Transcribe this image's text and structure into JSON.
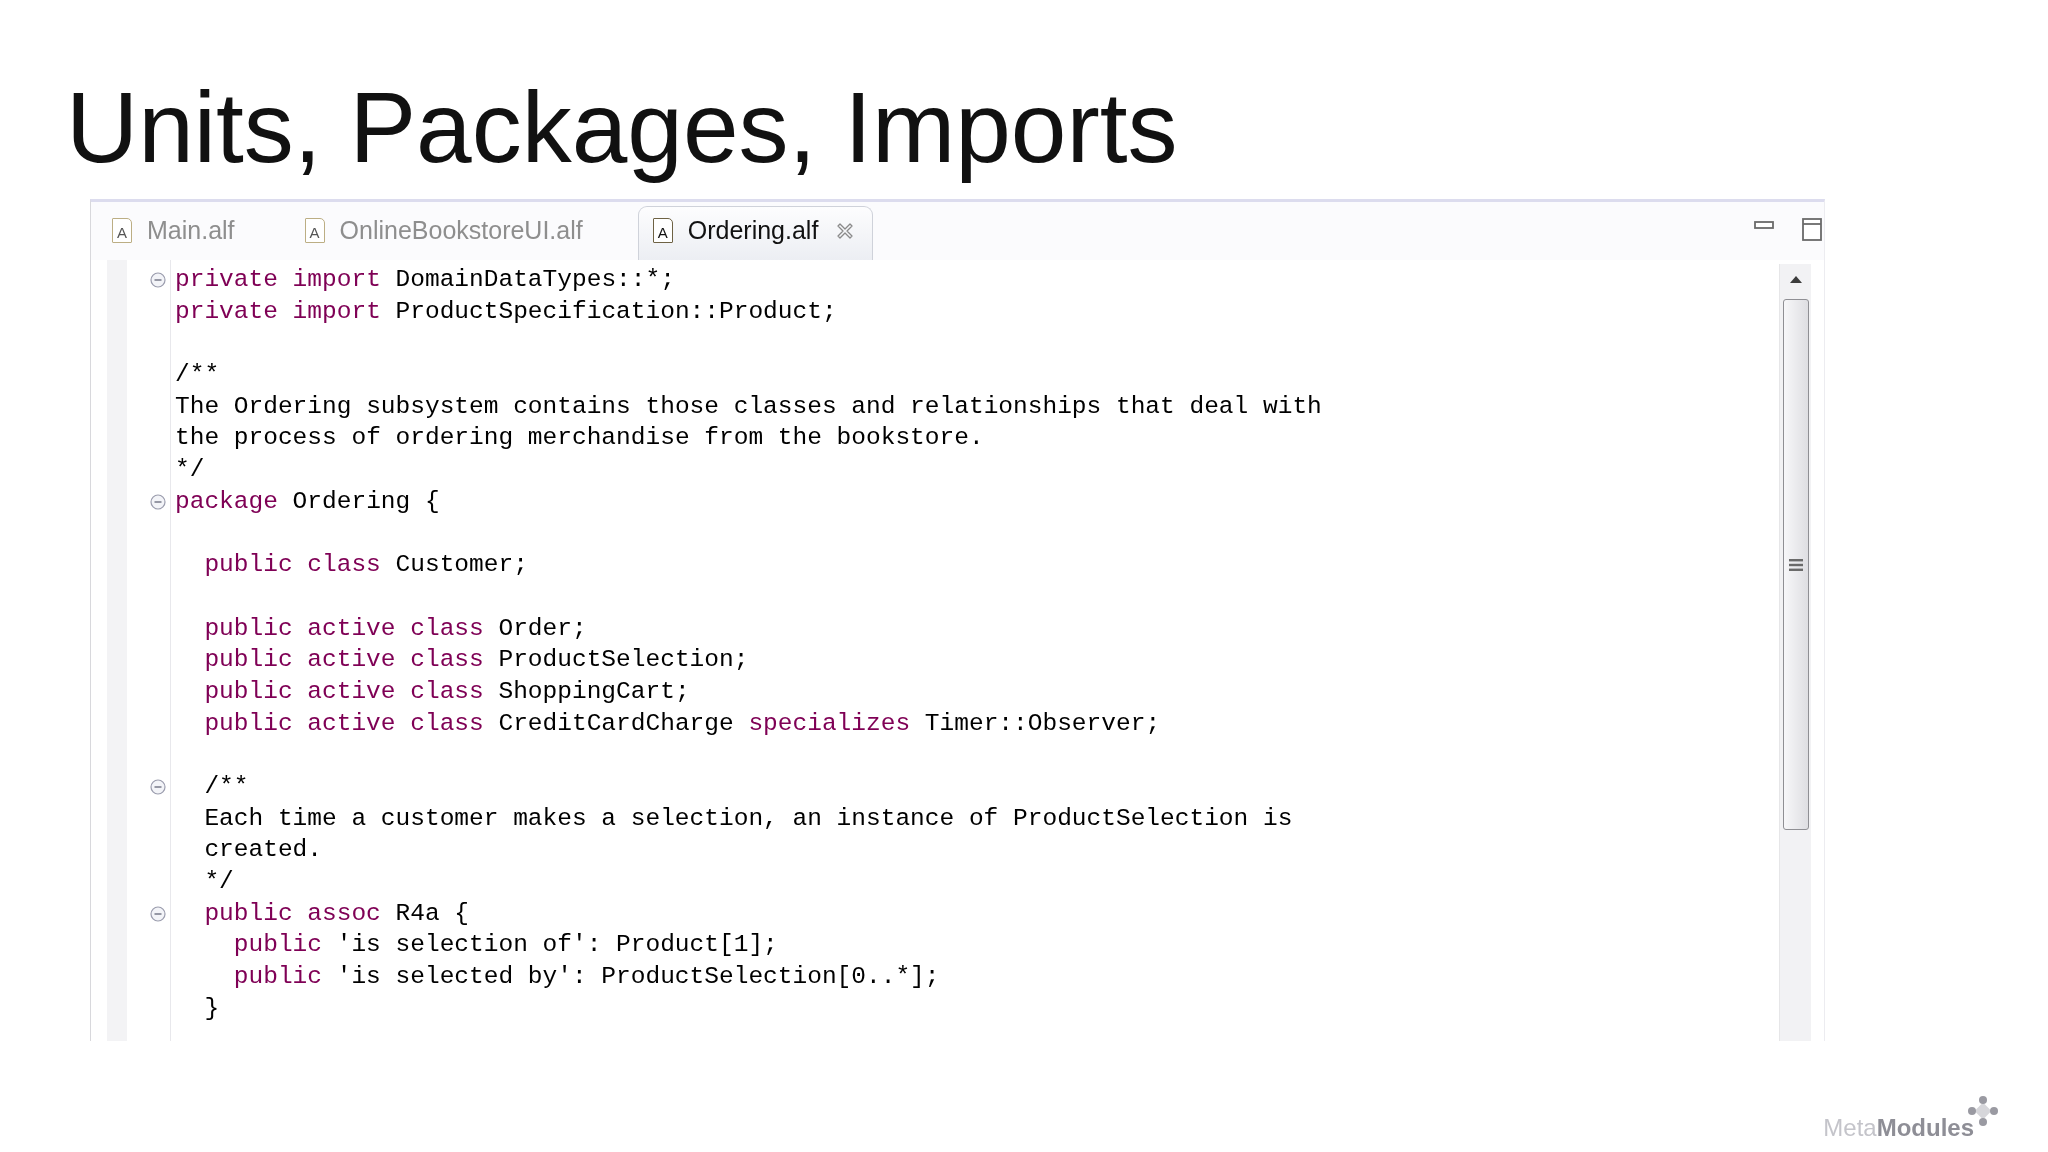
{
  "slide": {
    "title": "Units, Packages, Imports"
  },
  "editor": {
    "tabs": [
      {
        "label": "Main.alf",
        "icon_letter": "A",
        "selected": false
      },
      {
        "label": "OnlineBookstoreUI.alf",
        "icon_letter": "A",
        "selected": false
      },
      {
        "label": "Ordering.alf",
        "icon_letter": "A",
        "selected": true
      }
    ],
    "lines": [
      {
        "kind": "code",
        "fold_marker": true,
        "tokens": [
          {
            "kind": "keyword",
            "text": "private import"
          },
          {
            "kind": "plain",
            "text": " DomainDataTypes::*;"
          }
        ]
      },
      {
        "kind": "code",
        "fold_marker": false,
        "tokens": [
          {
            "kind": "keyword",
            "text": "private import"
          },
          {
            "kind": "plain",
            "text": " ProductSpecification::Product;"
          }
        ]
      },
      {
        "kind": "blank",
        "fold_marker": false
      },
      {
        "kind": "code",
        "fold_marker": false,
        "tokens": [
          {
            "kind": "plain",
            "text": "/**"
          }
        ]
      },
      {
        "kind": "code",
        "fold_marker": false,
        "tokens": [
          {
            "kind": "plain",
            "text": "The Ordering subsystem contains those classes and relationships that deal with"
          }
        ]
      },
      {
        "kind": "code",
        "fold_marker": false,
        "tokens": [
          {
            "kind": "plain",
            "text": "the process of ordering merchandise from the bookstore."
          }
        ]
      },
      {
        "kind": "code",
        "fold_marker": false,
        "tokens": [
          {
            "kind": "plain",
            "text": "*/"
          }
        ]
      },
      {
        "kind": "code",
        "fold_marker": true,
        "tokens": [
          {
            "kind": "keyword",
            "text": "package"
          },
          {
            "kind": "plain",
            "text": " Ordering {"
          }
        ],
        "children": [
          {
            "kind": "blank",
            "fold_marker": false
          },
          {
            "kind": "code",
            "fold_marker": false,
            "tokens": [
              {
                "kind": "keyword",
                "text": "public class"
              },
              {
                "kind": "plain",
                "text": " Customer;"
              }
            ]
          },
          {
            "kind": "blank",
            "fold_marker": false
          },
          {
            "kind": "code",
            "fold_marker": false,
            "tokens": [
              {
                "kind": "keyword",
                "text": "public active class"
              },
              {
                "kind": "plain",
                "text": " Order;"
              }
            ]
          },
          {
            "kind": "code",
            "fold_marker": false,
            "tokens": [
              {
                "kind": "keyword",
                "text": "public active class"
              },
              {
                "kind": "plain",
                "text": " ProductSelection;"
              }
            ]
          },
          {
            "kind": "code",
            "fold_marker": false,
            "tokens": [
              {
                "kind": "keyword",
                "text": "public active class"
              },
              {
                "kind": "plain",
                "text": " ShoppingCart;"
              }
            ]
          },
          {
            "kind": "code",
            "fold_marker": false,
            "tokens": [
              {
                "kind": "keyword",
                "text": "public active class"
              },
              {
                "kind": "plain",
                "text": " CreditCardCharge "
              },
              {
                "kind": "keyword",
                "text": "specializes"
              },
              {
                "kind": "plain",
                "text": " Timer::Observer;"
              }
            ]
          },
          {
            "kind": "blank",
            "fold_marker": false
          },
          {
            "kind": "code",
            "fold_marker": true,
            "tokens": [
              {
                "kind": "plain",
                "text": "/**"
              }
            ]
          },
          {
            "kind": "code",
            "fold_marker": false,
            "tokens": [
              {
                "kind": "plain",
                "text": "Each time a customer makes a selection, an instance of ProductSelection is"
              }
            ]
          },
          {
            "kind": "code",
            "fold_marker": false,
            "tokens": [
              {
                "kind": "plain",
                "text": "created."
              }
            ]
          },
          {
            "kind": "code",
            "fold_marker": false,
            "tokens": [
              {
                "kind": "plain",
                "text": "*/"
              }
            ]
          },
          {
            "kind": "code",
            "fold_marker": true,
            "tokens": [
              {
                "kind": "keyword",
                "text": "public assoc"
              },
              {
                "kind": "plain",
                "text": " R4a {"
              }
            ],
            "children": [
              {
                "kind": "code",
                "fold_marker": false,
                "tokens": [
                  {
                    "kind": "keyword",
                    "text": "public"
                  },
                  {
                    "kind": "plain",
                    "text": " 'is selection of': Product[1];"
                  }
                ]
              },
              {
                "kind": "code",
                "fold_marker": false,
                "tokens": [
                  {
                    "kind": "keyword",
                    "text": "public"
                  },
                  {
                    "kind": "plain",
                    "text": " 'is selected by': ProductSelection[0..*];"
                  }
                ]
              }
            ]
          },
          {
            "kind": "code",
            "fold_marker": false,
            "tokens": [
              {
                "kind": "plain",
                "text": "}"
              }
            ]
          }
        ]
      }
    ]
  },
  "logo": "Meta**Modules**"
}
